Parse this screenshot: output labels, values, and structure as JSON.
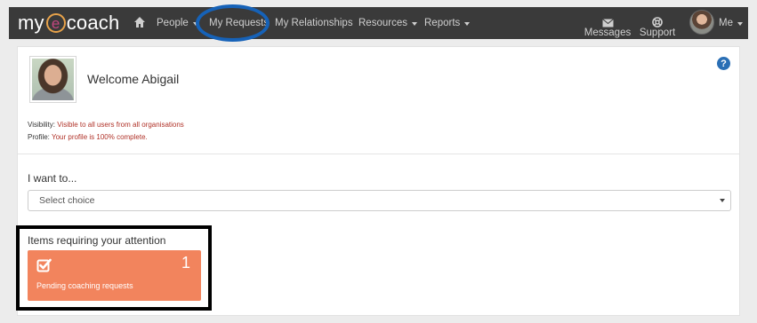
{
  "navbar": {
    "logo_prefix": "my",
    "logo_e": "e",
    "logo_suffix": "coach",
    "items": [
      {
        "label": "People",
        "has_dropdown": true
      },
      {
        "label": "My Requests",
        "has_dropdown": false
      },
      {
        "label": "My Relationships",
        "has_dropdown": false
      },
      {
        "label": "Resources",
        "has_dropdown": true
      },
      {
        "label": "Reports",
        "has_dropdown": true
      }
    ],
    "messages_label": "Messages",
    "support_label": "Support",
    "me_label": "Me",
    "highlight_color": "#1662b8"
  },
  "profile": {
    "welcome_text": "Welcome Abigail",
    "visibility_label": "Visibility:",
    "visibility_value": "Visible to all users from all organisations",
    "profile_label": "Profile:",
    "profile_value": "Your profile is 100% complete."
  },
  "want": {
    "label": "I want to...",
    "select_value": "Select choice"
  },
  "attention": {
    "title": "Items requiring your attention",
    "card": {
      "count": "1",
      "label": "Pending coaching requests",
      "color": "#f2845d"
    }
  },
  "colors": {
    "navbar_bg": "#3a3a3a",
    "accent_blue": "#2a6fb5",
    "info_red": "#b03228"
  }
}
